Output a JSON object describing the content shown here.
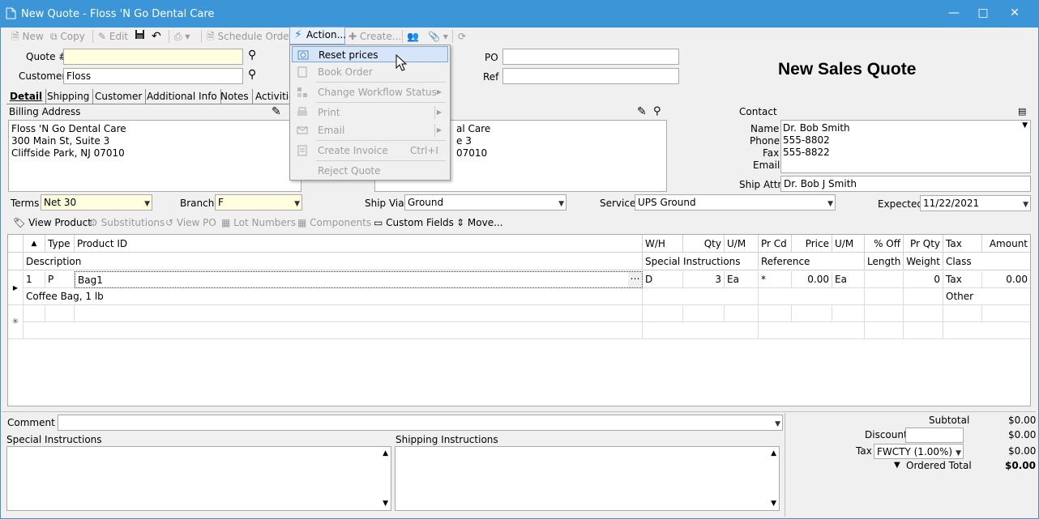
{
  "window": {
    "title": "New Quote - Floss 'N Go Dental Care"
  },
  "toolbar": {
    "new_label": "New",
    "copy_label": "Copy",
    "edit_label": "Edit",
    "schedule_order_label": "Schedule Order",
    "action_label": "Action...",
    "create_label": "Create..."
  },
  "action_menu": {
    "items": [
      {
        "label": "Reset prices",
        "enabled": true
      },
      {
        "label": "Book Order",
        "enabled": false
      },
      {
        "label": "Change Workflow Status",
        "enabled": false
      },
      {
        "label": "Print",
        "enabled": false
      },
      {
        "label": "Email",
        "enabled": false
      },
      {
        "label": "Create Invoice",
        "shortcut": "Ctrl+I",
        "enabled": false
      },
      {
        "label": "Reject Quote",
        "enabled": false
      }
    ]
  },
  "header": {
    "quote_label": "Quote #",
    "quote_value": "",
    "customer_label": "Customer",
    "customer_value": "Floss",
    "po_label": "PO",
    "po_value": "",
    "ref_label": "Ref",
    "ref_value": "",
    "heading": "New Sales Quote"
  },
  "tabs": [
    "Detail",
    "Shipping",
    "Customer",
    "Additional Info",
    "Notes",
    "Activities"
  ],
  "billing": {
    "label": "Billing Address",
    "lines": [
      "Floss 'N Go Dental Care",
      "300 Main St, Suite 3",
      "Cliffside Park, NJ 07010"
    ]
  },
  "shipping_addr": {
    "lines": [
      "al Care",
      "e 3",
      "07010"
    ]
  },
  "contact": {
    "label": "Contact",
    "name_label": "Name",
    "name": "Dr. Bob Smith",
    "phone_label": "Phone",
    "phone": "555-8802",
    "fax_label": "Fax",
    "fax": "555-8822",
    "email_label": "Email",
    "email": "",
    "ship_attn_label": "Ship Attn",
    "ship_attn": "Dr. Bob J Smith"
  },
  "terms": {
    "label": "Terms",
    "value": "Net 30"
  },
  "branch": {
    "label": "Branch",
    "value": "F"
  },
  "ship_via": {
    "label": "Ship Via",
    "value": "Ground"
  },
  "service": {
    "label": "Service",
    "value": "UPS Ground"
  },
  "expected": {
    "label": "Expected",
    "value": "11/22/2021"
  },
  "line_toolbar": {
    "view_product": "View Product",
    "substitutions": "Substitutions",
    "view_po": "View PO",
    "lot_numbers": "Lot Numbers",
    "components": "Components",
    "custom_fields": "Custom Fields",
    "move": "Move..."
  },
  "grid": {
    "h1": {
      "type": "Type",
      "product_id": "Product ID",
      "wh": "W/H",
      "qty": "Qty",
      "um": "U/M",
      "prcd": "Pr Cd",
      "price": "Price",
      "um2": "U/M",
      "off": "% Off",
      "prqty": "Pr Qty",
      "tax": "Tax",
      "amount": "Amount"
    },
    "h2": {
      "description": "Description",
      "special": "Special Instructions",
      "reference": "Reference",
      "length": "Length",
      "weight": "Weight",
      "class": "Class"
    },
    "row": {
      "num": "1",
      "type": "P",
      "product_id": "Bag1",
      "wh": "D",
      "qty": "3",
      "um": "Ea",
      "prcd": "*",
      "price": "0.00",
      "um2": "Ea",
      "prqty": "0",
      "tax": "Tax",
      "amount": "0.00",
      "description": "Coffee Bag, 1 lb",
      "class": "Other"
    }
  },
  "footer": {
    "comment_label": "Comment",
    "special_label": "Special Instructions",
    "shipping_label": "Shipping Instructions",
    "subtotal_label": "Subtotal",
    "subtotal": "$0.00",
    "discount_label": "Discount",
    "discount": "$0.00",
    "tax_label": "Tax",
    "tax_code": "FWCTY (1.00%)",
    "tax": "$0.00",
    "ordered_label": "Ordered Total",
    "ordered": "$0.00"
  }
}
